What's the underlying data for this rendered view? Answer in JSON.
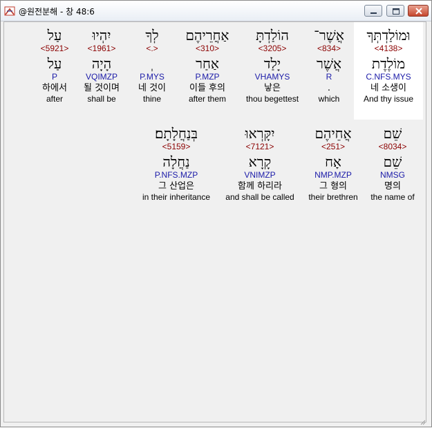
{
  "window": {
    "title": "@원전분해 - 창 48:6",
    "minimize_label": "minimize",
    "maximize_label": "maximize",
    "close_label": "close"
  },
  "colors": {
    "strong": "#8b0000",
    "parse": "#1a1aa8",
    "highlight": "#ffffff",
    "background": "#f0f0f0"
  },
  "words": [
    {
      "hebrew": "וּמוֹלַדְתְּךָ",
      "strong": "<4138>",
      "lemma": "מוֹלֶדֶת",
      "parse": "C.NFS.MYS",
      "korean": "네 소생이",
      "english": "And thy issue",
      "selected": true
    },
    {
      "hebrew": "אֲשֶׁר־",
      "strong": "<834>",
      "lemma": "אֲשֶׁר",
      "parse": "R",
      "korean": ".",
      "english": "which",
      "selected": false
    },
    {
      "hebrew": "הוֹלַדְתָּ",
      "strong": "<3205>",
      "lemma": "יָלַד",
      "parse": "VHAMYS",
      "korean": "낳은",
      "english": "thou begettest",
      "selected": false
    },
    {
      "hebrew": "אַחֲרֵיהֶם",
      "strong": "<310>",
      "lemma": "אַחַר",
      "parse": "P.MZP",
      "korean": "이들 후의",
      "english": "after them",
      "selected": false
    },
    {
      "hebrew": "לְךָ",
      "strong": "<.>",
      "lemma": "ְ",
      "parse": "P.MYS",
      "korean": "네 것이",
      "english": "thine",
      "selected": false
    },
    {
      "hebrew": "יִהְיוּ",
      "strong": "<1961>",
      "lemma": "הָיָה",
      "parse": "VQIMZP",
      "korean": "될 것이며",
      "english": "shall be",
      "selected": false
    },
    {
      "hebrew": "עַל",
      "strong": "<5921>",
      "lemma": "עַל",
      "parse": "P",
      "korean": "하에서",
      "english": "after",
      "selected": false
    },
    {
      "hebrew": "שֵׁם",
      "strong": "<8034>",
      "lemma": "שֵׁם",
      "parse": "NMSG",
      "korean": "명의",
      "english": "the name of",
      "selected": false
    },
    {
      "hebrew": "אֲחֵיהֶם",
      "strong": "<251>",
      "lemma": "אָח",
      "parse": "NMP.MZP",
      "korean": "그 형의",
      "english": "their brethren",
      "selected": false
    },
    {
      "hebrew": "יִקָּרְאוּ",
      "strong": "<7121>",
      "lemma": "קָרָא",
      "parse": "VNIMZP",
      "korean": "함께 하리라",
      "english": "and shall be called",
      "selected": false
    },
    {
      "hebrew": "בְּנַחֲלָתָם׃",
      "strong": "<5159>",
      "lemma": "נַחֲלָה",
      "parse": "P.NFS.MZP",
      "korean": "그 산업은",
      "english": "in their inheritance",
      "selected": false
    }
  ]
}
